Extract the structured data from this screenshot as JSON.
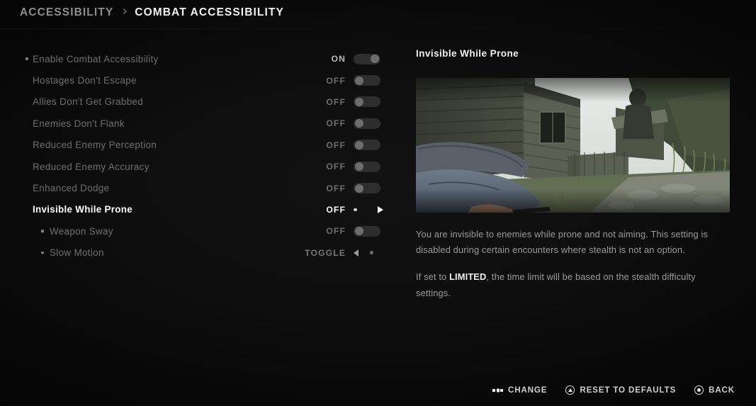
{
  "header": {
    "breadcrumb_root": "ACCESSIBILITY",
    "breadcrumb_current": "COMBAT ACCESSIBILITY"
  },
  "settings": {
    "rows": [
      {
        "label": "Enable Combat Accessibility",
        "value": "ON",
        "control": "toggle-on",
        "state": "enabled-dim",
        "marker": "dot"
      },
      {
        "label": "Hostages Don't Escape",
        "value": "OFF",
        "control": "toggle-off",
        "state": "dim",
        "marker": "none"
      },
      {
        "label": "Allies Don't Get Grabbed",
        "value": "OFF",
        "control": "toggle-off",
        "state": "dim",
        "marker": "none"
      },
      {
        "label": "Enemies Don't Flank",
        "value": "OFF",
        "control": "toggle-off",
        "state": "dim",
        "marker": "none"
      },
      {
        "label": "Reduced Enemy Perception",
        "value": "OFF",
        "control": "toggle-off",
        "state": "dim",
        "marker": "none"
      },
      {
        "label": "Reduced Enemy Accuracy",
        "value": "OFF",
        "control": "toggle-off",
        "state": "dim",
        "marker": "none"
      },
      {
        "label": "Enhanced Dodge",
        "value": "OFF",
        "control": "toggle-off",
        "state": "dim",
        "marker": "none"
      },
      {
        "label": "Invisible While Prone",
        "value": "OFF",
        "control": "carousel-right",
        "state": "selected",
        "marker": "none"
      },
      {
        "label": "Weapon Sway",
        "value": "OFF",
        "control": "toggle-off",
        "state": "sub",
        "marker": "square"
      },
      {
        "label": "Slow Motion",
        "value": "TOGGLE",
        "control": "carousel-left",
        "state": "sub",
        "marker": "square"
      }
    ]
  },
  "detail": {
    "title": "Invisible While Prone",
    "preview_alt": "prone-gameplay-screenshot",
    "paragraph_1": "You are invisible to enemies while prone and not aiming. This setting is disabled during certain encounters where stealth is not an option.",
    "paragraph_2_pre": "If set to ",
    "paragraph_2_bold": "LIMITED",
    "paragraph_2_post": ", the time limit will be based on the stealth difficulty settings."
  },
  "prompts": [
    {
      "icon": "dpad-left-right-icon",
      "label": "CHANGE"
    },
    {
      "icon": "triangle-button-icon",
      "label": "RESET TO DEFAULTS"
    },
    {
      "icon": "circle-button-icon",
      "label": "BACK"
    }
  ],
  "colors": {
    "background": "#0a0a0a",
    "text_bright": "#ffffff",
    "text_dim": "#6e6e6e",
    "accent": "#cfcfcf"
  }
}
